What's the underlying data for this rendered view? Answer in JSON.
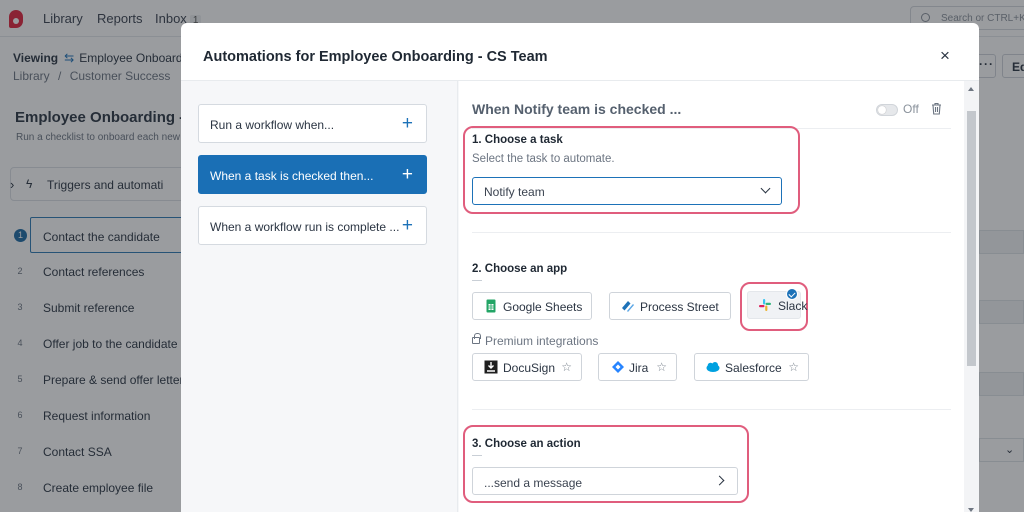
{
  "app": {
    "nav": {
      "library": "Library",
      "reports": "Reports",
      "inbox": "Inbox",
      "inbox_count": "1"
    },
    "search_placeholder": "Search or CTRL+K",
    "viewing_label": "Viewing",
    "viewing_name": "Employee Onboardin",
    "breadcrumb": {
      "root": "Library",
      "sep": "/",
      "folder": "Customer Success"
    },
    "right_button": "Ed",
    "page_title": "Employee Onboarding - C",
    "page_subtitle": "Run a checklist to onboard each new",
    "triggers_label": "Triggers and automati",
    "tasks": [
      {
        "num": "1",
        "label": "Contact the candidate"
      },
      {
        "num": "2",
        "label": "Contact references"
      },
      {
        "num": "3",
        "label": "Submit reference"
      },
      {
        "num": "4",
        "label": "Offer job to the candidate"
      },
      {
        "num": "5",
        "label": "Prepare & send offer letter"
      },
      {
        "num": "6",
        "label": "Request information"
      },
      {
        "num": "7",
        "label": "Contact SSA"
      },
      {
        "num": "8",
        "label": "Create employee file"
      }
    ]
  },
  "modal": {
    "title": "Automations for Employee Onboarding - CS Team",
    "close": "×",
    "triggers": [
      {
        "label": "Run a workflow when...",
        "plus": "+"
      },
      {
        "label": "When a task is checked then...",
        "plus": "+"
      },
      {
        "label": "When a workflow run is complete ...",
        "plus": "+"
      }
    ],
    "header": "When Notify team is checked ...",
    "toggle_label": "Off",
    "step1": {
      "title": "1. Choose a task",
      "subtitle": "Select the task to automate.",
      "selected": "Notify team"
    },
    "step2": {
      "title": "2. Choose an app",
      "apps": [
        "Google Sheets",
        "Process Street",
        "Slack"
      ],
      "premium_label": "Premium integrations",
      "premium_apps": [
        "DocuSign",
        "Jira",
        "Salesforce"
      ],
      "star": "☆"
    },
    "step3": {
      "title": "3. Choose an action",
      "value": "...send a message"
    }
  },
  "colors": {
    "accent": "#1a6fb5",
    "highlight": "#e05d7d",
    "brand": "#e2233d"
  }
}
